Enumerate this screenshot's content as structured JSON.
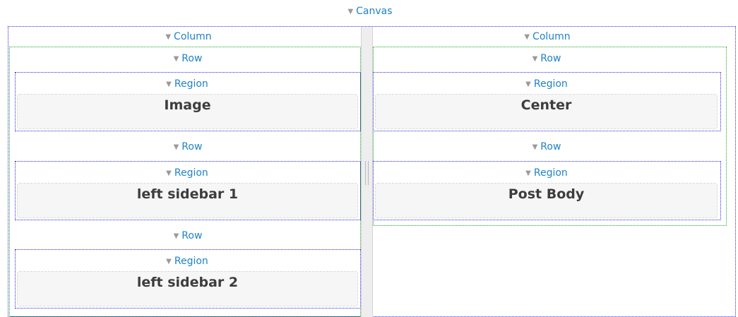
{
  "canvas": {
    "label": "Canvas"
  },
  "left_column": {
    "label": "Column",
    "rows": [
      {
        "row_label": "Row",
        "region_label": "Region",
        "title": "Image"
      },
      {
        "row_label": "Row",
        "region_label": "Region",
        "title": "left sidebar 1"
      },
      {
        "row_label": "Row",
        "region_label": "Region",
        "title": "left sidebar 2"
      }
    ]
  },
  "right_column": {
    "label": "Column",
    "rows": [
      {
        "row_label": "Row",
        "region_label": "Region",
        "title": "Center"
      },
      {
        "row_label": "Row",
        "region_label": "Region",
        "title": "Post Body"
      }
    ]
  },
  "colors": {
    "link": "#1f83c6",
    "canvas_border": "#2a2adf",
    "row_border": "#22a822",
    "panel_bg": "#f6f6f6"
  },
  "icons": {
    "toggle": "triangle-down-icon"
  }
}
